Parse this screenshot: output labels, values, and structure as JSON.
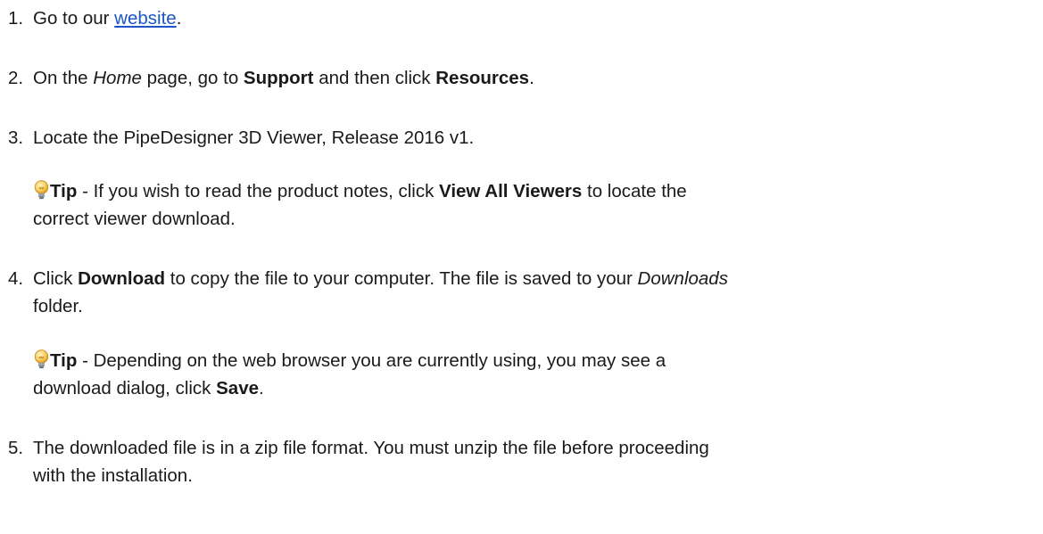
{
  "steps": [
    {
      "num": "1.",
      "pre": "Go to our ",
      "link": "website",
      "post": "."
    },
    {
      "num": "2.",
      "pre": "On the ",
      "home": "Home",
      "mid1": " page, go to ",
      "support": "Support",
      "mid2": " and then click ",
      "resources": "Resources",
      "post": "."
    },
    {
      "num": "3.",
      "text": "Locate the PipeDesigner 3D Viewer, Release  2016 v1."
    },
    {
      "num": "4.",
      "pre": "Click ",
      "download": "Download",
      "mid": " to copy the file to your computer. The file is saved to your ",
      "downloads": "Downloads",
      "line2": "folder."
    },
    {
      "num": "5.",
      "line1": "The downloaded file is in a zip file format. You must unzip the file before proceeding",
      "line2": "with the installation."
    }
  ],
  "tip1": {
    "label": "Tip",
    "pre": " - If you wish to read the product notes, click ",
    "bold": "View All Viewers",
    "post": " to locate the",
    "line2": "correct viewer download."
  },
  "tip2": {
    "label": "Tip",
    "pre": " - Depending on the web browser you are currently using, you may see a",
    "line2_pre": "download dialog, click ",
    "bold": "Save",
    "line2_post": "."
  },
  "icons": {
    "tip": "lightbulb-icon"
  },
  "colors": {
    "link": "#1a56c9",
    "bulb": "#f3b93a"
  }
}
